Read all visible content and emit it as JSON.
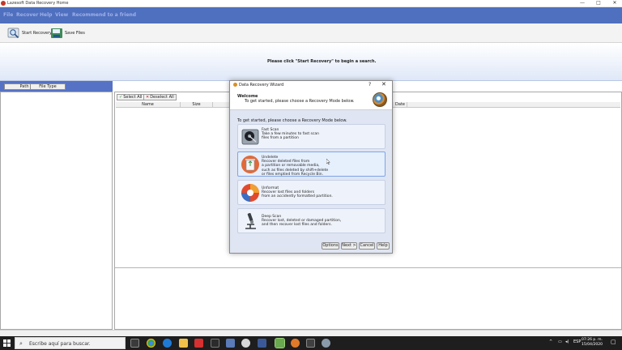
{
  "window": {
    "title": "Lazesoft Data Recovery Home",
    "controls": [
      "—",
      "□",
      "✕"
    ]
  },
  "menu": [
    "File",
    "Recover",
    "Help",
    "View",
    "Recommend to a friend"
  ],
  "toolbar": {
    "start_recovery": "Start Recovery",
    "save_files": "Save Files"
  },
  "banner": {
    "message": "Please click \"Start Recovery\" to begin a search."
  },
  "left_tabs": [
    "Path",
    "File Type"
  ],
  "right_panel": {
    "select_all": "Select All",
    "deselect_all": "Deselect All",
    "columns": [
      "Name",
      "Size",
      "Date"
    ]
  },
  "dialog": {
    "title": "Data Recovery Wizard",
    "help_glyph": "?",
    "close_glyph": "✕",
    "header_title": "Welcome",
    "header_subtitle": "To get started, please choose a Recovery Mode below.",
    "intro": "To get started, please choose a Recovery Mode below.",
    "options": [
      {
        "title": "Fast Scan",
        "lines": [
          "Take a few minutes to fast scan",
          "files from a partition"
        ],
        "icon": "hard-drive-icon"
      },
      {
        "title": "Undelete",
        "lines": [
          "Recover deleted files from",
          "a partition or removable media,",
          "such as files deleted by shift+delete",
          "or files emptied from Recycle Bin."
        ],
        "icon": "recycle-bin-icon",
        "selected": true
      },
      {
        "title": "Unformat",
        "lines": [
          "Recover lost files and folders",
          "from an accidently formatted partition."
        ],
        "icon": "unformat-icon"
      },
      {
        "title": "Deep Scan",
        "lines": [
          "Recover lost, deleted or damaged partition,",
          "and then recover lost files and folders."
        ],
        "icon": "microscope-icon"
      }
    ],
    "buttons": {
      "options": "Options",
      "next": "Next >",
      "cancel": "Cancel",
      "help": "Help"
    }
  },
  "taskbar": {
    "search_placeholder": "Escribe aquí para buscar.",
    "tray_lang": "ESP",
    "time": "07:26 p. m.",
    "date": "15/04/2020",
    "tray_arrow": "^"
  },
  "colors": {
    "menubar": "#4f6fbf",
    "taskbar": "#1e1e1e",
    "dialog_body": "#dfe5f2",
    "selected_option_border": "#7ea6e6"
  }
}
